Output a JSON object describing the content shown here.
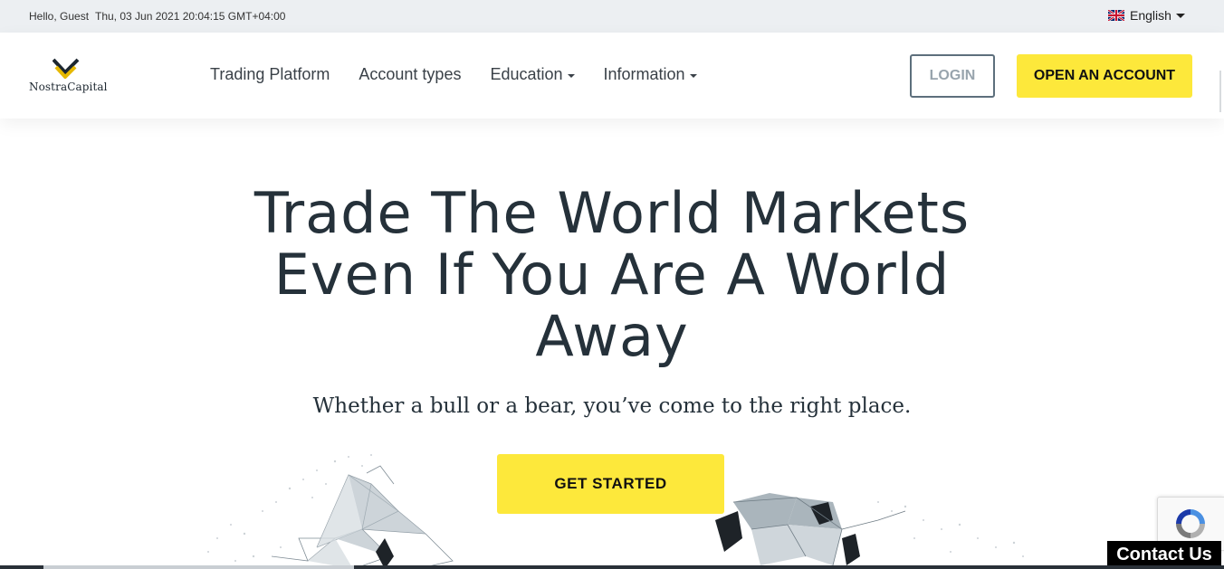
{
  "topbar": {
    "greeting": "Hello, Guest",
    "datetime": "Thu, 03 Jun 2021 20:04:15 GMT+04:00",
    "language": "English"
  },
  "header": {
    "logo_text": "NostraCapital",
    "nav": [
      {
        "label": "Trading Platform",
        "has_dropdown": false
      },
      {
        "label": "Account types",
        "has_dropdown": false
      },
      {
        "label": "Education",
        "has_dropdown": true
      },
      {
        "label": "Information",
        "has_dropdown": true
      }
    ],
    "login_label": "LOGIN",
    "open_account_label": "OPEN AN ACCOUNT"
  },
  "hero": {
    "title_line1": "Trade The World Markets",
    "title_line2": "Even If You Are A World",
    "title_line3": "Away",
    "subtitle": "Whether a bull or a bear, you’ve come to the right place.",
    "cta_label": "GET STARTED"
  },
  "widgets": {
    "contact_label": "Contact Us"
  },
  "colors": {
    "accent_yellow": "#fde83b",
    "text_dark": "#25313a",
    "topbar_bg": "#eceff2"
  },
  "icons": [
    "uk-flag-icon",
    "chevron-down-icon",
    "nostracapital-logo",
    "recaptcha-icon",
    "bull-illustration",
    "bear-illustration"
  ]
}
